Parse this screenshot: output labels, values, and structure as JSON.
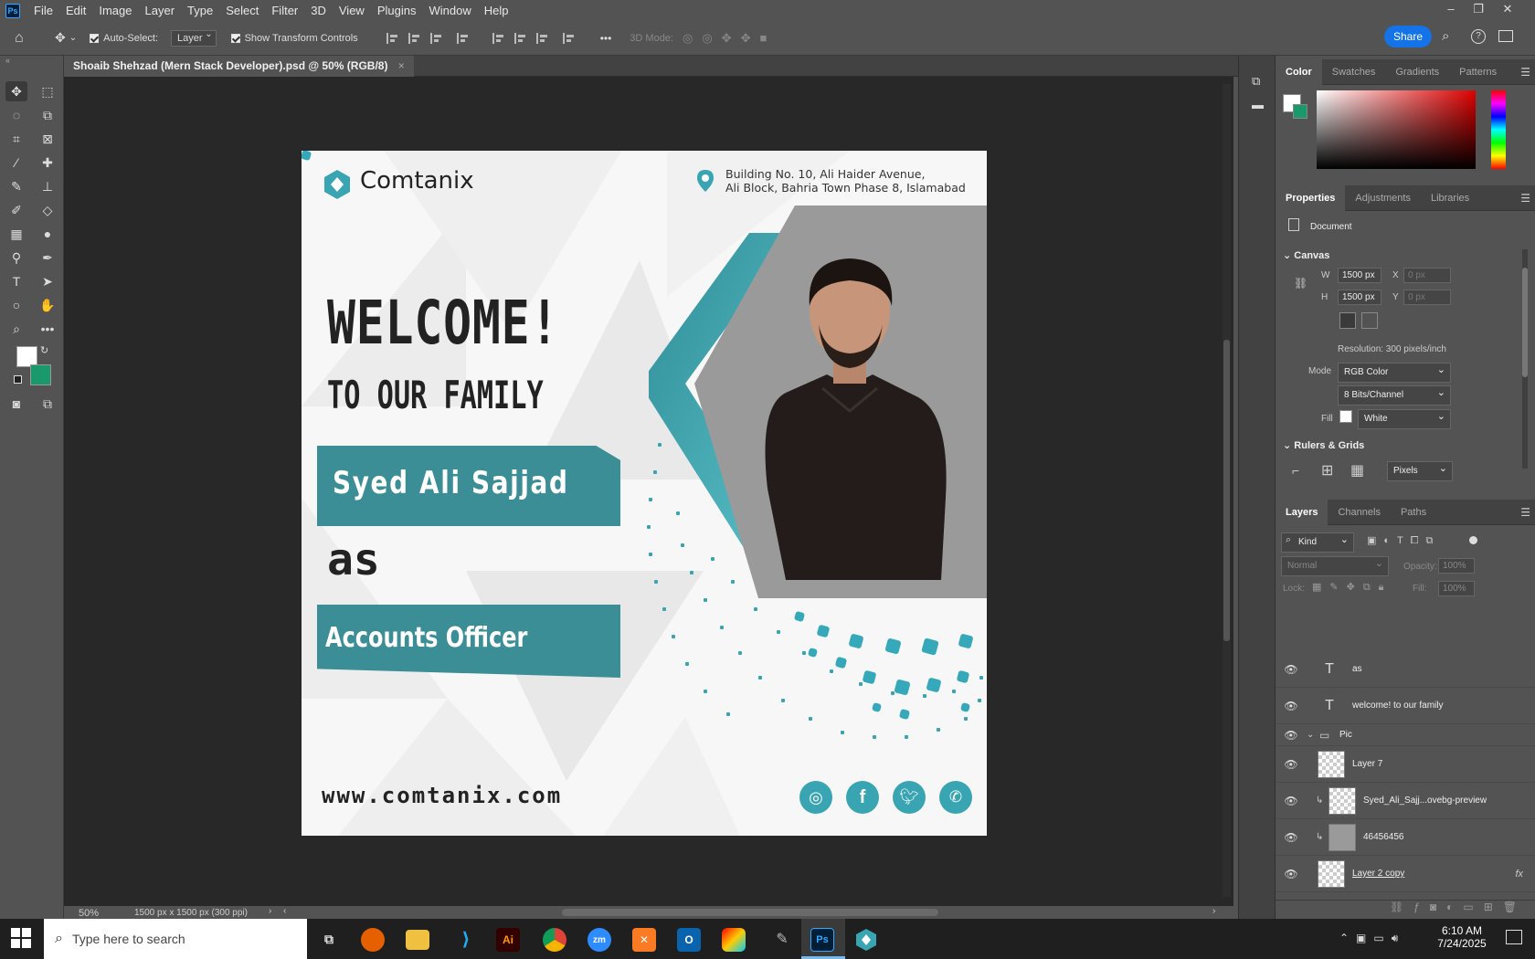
{
  "menubar": {
    "app_icon": "Ps",
    "items": [
      "File",
      "Edit",
      "Image",
      "Layer",
      "Type",
      "Select",
      "Filter",
      "3D",
      "View",
      "Plugins",
      "Window",
      "Help"
    ]
  },
  "optbar": {
    "auto_select": "Auto-Select:",
    "layer_select": "Layer",
    "transform": "Show Transform Controls",
    "mode3d": "3D Mode:",
    "share": "Share",
    "more": "•••"
  },
  "document": {
    "tab_title": "Shoaib Shehzad (Mern Stack Developer).psd @ 50% (RGB/8)",
    "close": "×"
  },
  "status": {
    "zoom": "50%",
    "size": "1500 px x 1500 px (300 ppi)"
  },
  "poster": {
    "logo": "Comtanix",
    "address_line1": "Building No. 10, Ali Haider Avenue,",
    "address_line2": "Ali Block, Bahria Town Phase 8, Islamabad",
    "welcome": "WELCOME!",
    "to_family": "TO OUR FAMILY",
    "name": "Syed Ali Sajjad",
    "as": "as",
    "position": "Accounts Officer",
    "website": "www.comtanix.com",
    "teal": "#3c8e96"
  },
  "color_panel": {
    "tabs": [
      "Color",
      "Swatches",
      "Gradients",
      "Patterns"
    ],
    "foreground": "#ffffff",
    "background": "#1a9a6c"
  },
  "properties": {
    "tabs": [
      "Properties",
      "Adjustments",
      "Libraries"
    ],
    "doc_label": "Document",
    "canvas_header": "Canvas",
    "w_label": "W",
    "w_value": "1500 px",
    "h_label": "H",
    "h_value": "1500 px",
    "x_label": "X",
    "x_value": "0 px",
    "y_label": "Y",
    "y_value": "0 px",
    "resolution": "Resolution: 300 pixels/inch",
    "mode_label": "Mode",
    "mode_value": "RGB Color",
    "bits_value": "8 Bits/Channel",
    "fill_label": "Fill",
    "fill_value": "White",
    "rulers_header": "Rulers & Grids",
    "units_value": "Pixels"
  },
  "layers": {
    "tabs": [
      "Layers",
      "Channels",
      "Paths"
    ],
    "kind": "Kind",
    "blend": "Normal",
    "opacity_label": "Opacity:",
    "opacity_value": "100%",
    "lock_label": "Lock:",
    "fill_label": "Fill:",
    "fill_value": "100%",
    "items": [
      {
        "name": "as"
      },
      {
        "name": "welcome!  to our family"
      },
      {
        "name": "Pic"
      },
      {
        "name": "Layer 7"
      },
      {
        "name": "Syed_Ali_Sajj...ovebg-preview"
      },
      {
        "name": "46456456"
      },
      {
        "name": "Layer 2 copy"
      }
    ],
    "fx": "fx"
  },
  "taskbar": {
    "search_placeholder": "Type here to search",
    "time": "6:10 AM",
    "date": "7/24/2025"
  }
}
